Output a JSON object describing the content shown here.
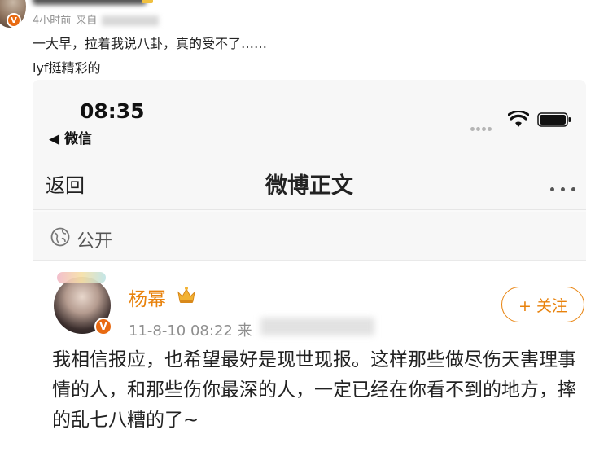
{
  "post": {
    "meta_time": "4小时前",
    "meta_source_prefix": "来自",
    "text_line1": "一大早，拉着我说八卦，真的受不了……",
    "text_line2": "lyf挺精彩的"
  },
  "phone": {
    "clock": "08:35",
    "back_app": "◀ 微信"
  },
  "nav": {
    "back_label": "返回",
    "title": "微博正文"
  },
  "visibility": {
    "label": "公开"
  },
  "weibo": {
    "username": "杨幂",
    "time": "11-8-10 08:22",
    "from_prefix": "来",
    "follow_label": "+ 关注",
    "content": "我相信报应，也希望最好是现世现报。这样那些做尽伤天害理事情的人，和那些伤你最深的人，一定已经在你看不到的地方，摔的乱七八糟的了~"
  },
  "colors": {
    "accent": "#e8820c",
    "verified_badge": "#e86a12"
  }
}
